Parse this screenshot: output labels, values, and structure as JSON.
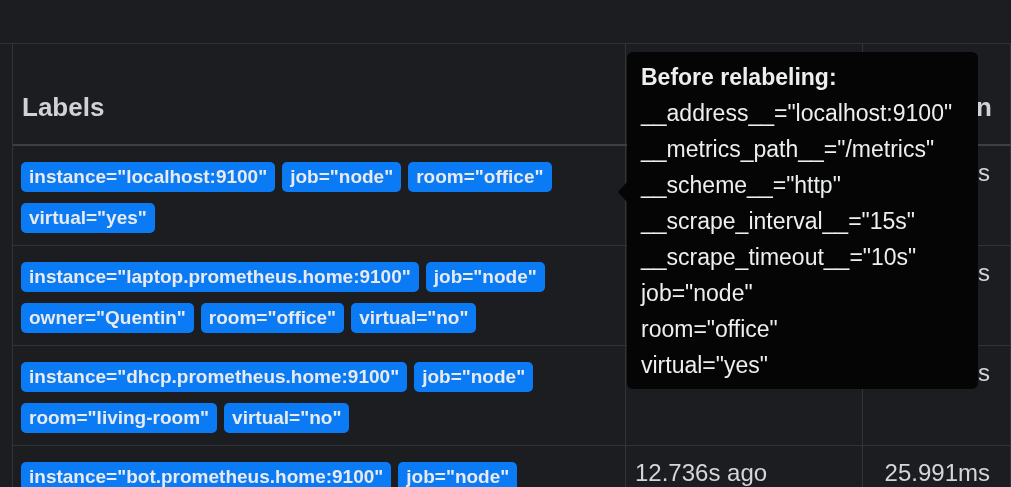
{
  "table": {
    "header": {
      "column_2": "Labels",
      "column_4": "n"
    },
    "rows": [
      {
        "labels": [
          "instance=\"localhost:9100\"",
          "job=\"node\"",
          "room=\"office\"",
          "virtual=\"yes\""
        ],
        "column_4": "s"
      },
      {
        "labels": [
          "instance=\"laptop.prometheus.home:9100\"",
          "job=\"node\"",
          "owner=\"Quentin\"",
          "room=\"office\"",
          "virtual=\"no\""
        ],
        "column_4": "s"
      },
      {
        "labels": [
          "instance=\"dhcp.prometheus.home:9100\"",
          "job=\"node\"",
          "room=\"living-room\"",
          "virtual=\"no\""
        ],
        "column_4": "s"
      },
      {
        "labels": [
          "instance=\"bot.prometheus.home:9100\"",
          "job=\"node\""
        ],
        "column_3": "12.736s ago",
        "column_4": "25.991ms"
      }
    ]
  },
  "tooltip": {
    "title": "Before relabeling:",
    "lines": [
      "__address__=\"localhost:9100\"",
      "__metrics_path__=\"/metrics\"",
      "__scheme__=\"http\"",
      "__scrape_interval__=\"15s\"",
      "__scrape_timeout__=\"10s\"",
      "job=\"node\"",
      "room=\"office\"",
      "virtual=\"yes\""
    ]
  }
}
